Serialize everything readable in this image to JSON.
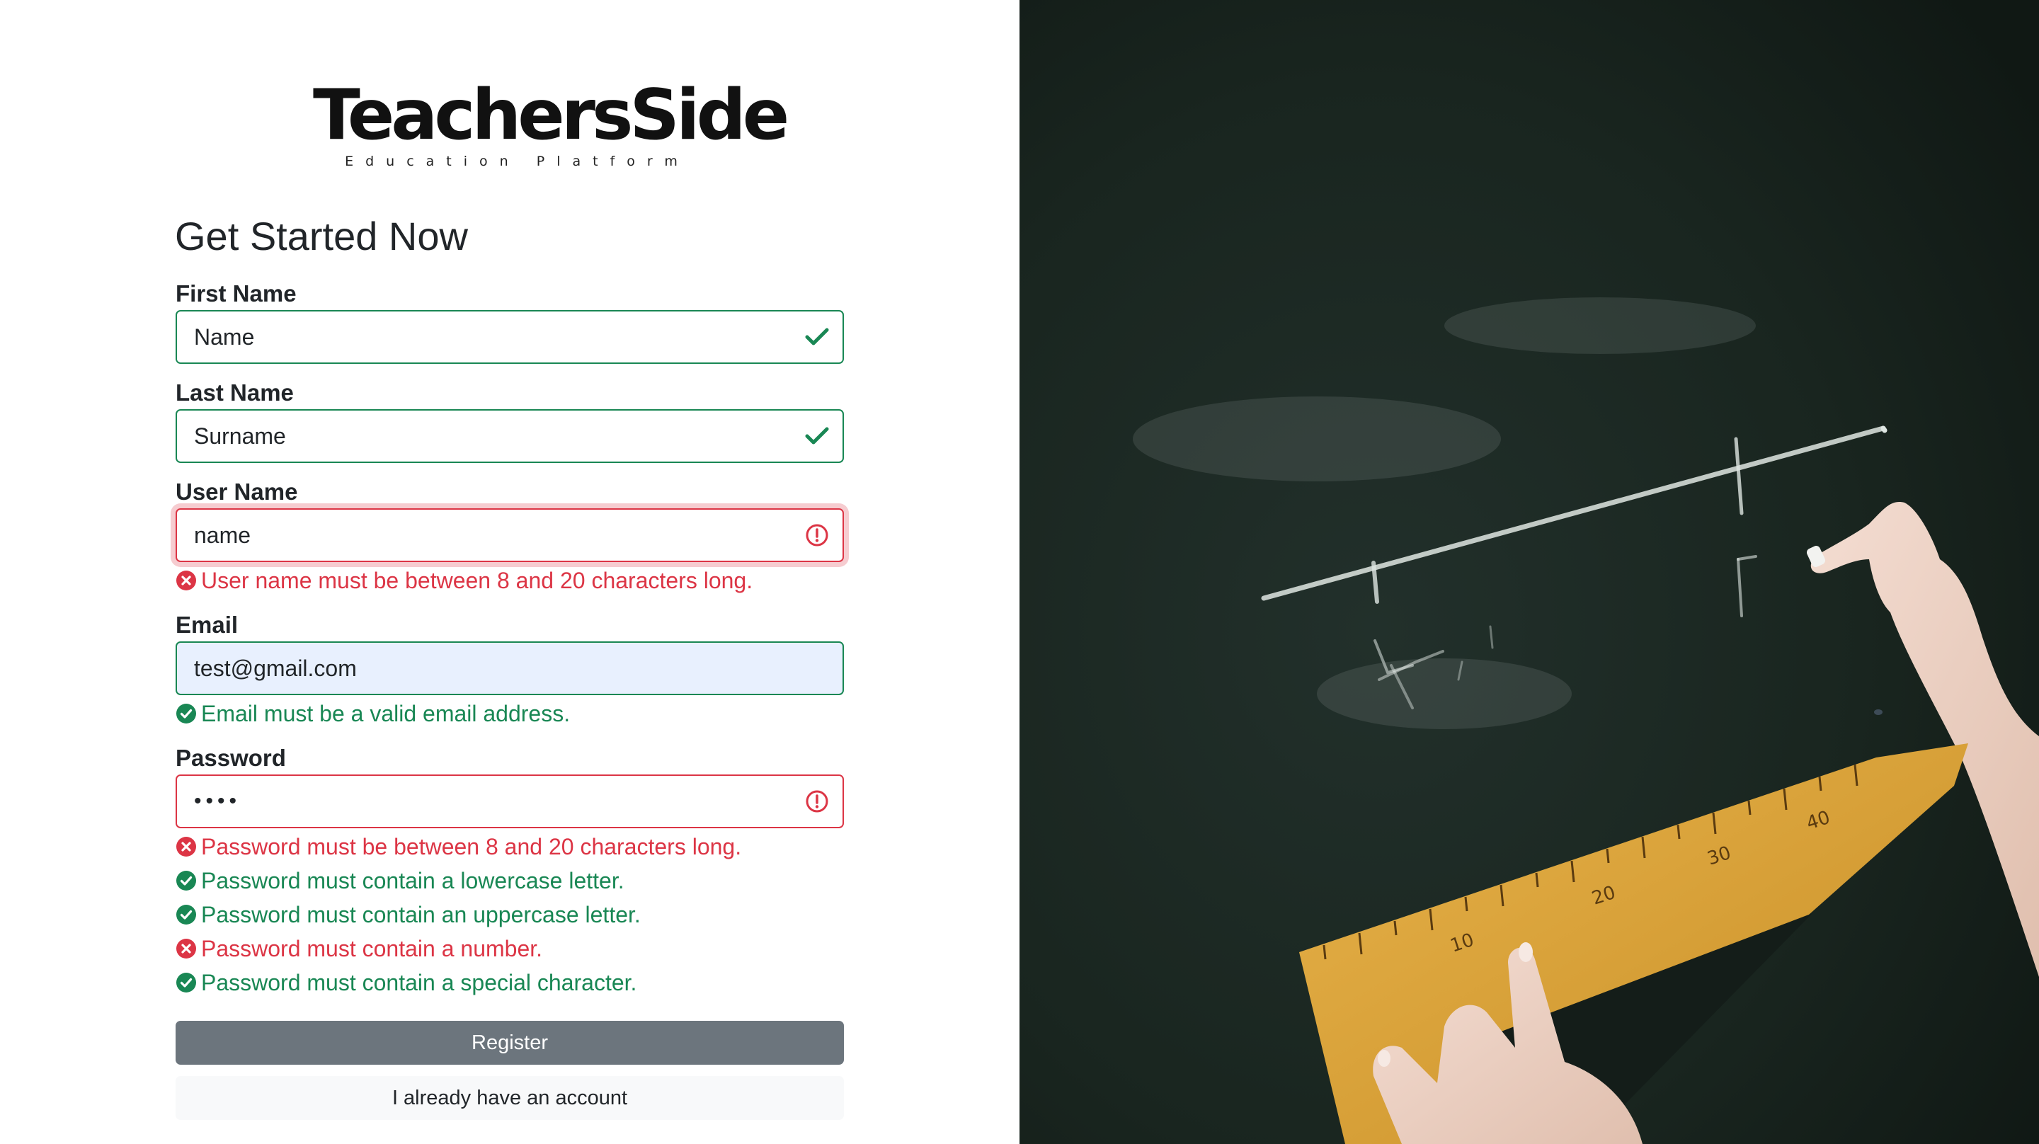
{
  "brand": {
    "name": "TeachersSide",
    "tagline": "Education Platform"
  },
  "form": {
    "title": "Get Started Now",
    "fields": {
      "first_name": {
        "label": "First Name",
        "value": "Name",
        "state": "valid"
      },
      "last_name": {
        "label": "Last Name",
        "value": "Surname",
        "state": "valid"
      },
      "user_name": {
        "label": "User Name",
        "value": "name",
        "state": "invalid",
        "feedback": [
          {
            "status": "error",
            "text": "User name must be between 8 and 20 characters long."
          }
        ]
      },
      "email": {
        "label": "Email",
        "value": "test@gmail.com",
        "state": "valid",
        "feedback": [
          {
            "status": "ok",
            "text": "Email must be a valid email address."
          }
        ]
      },
      "password": {
        "label": "Password",
        "value": "••••",
        "state": "invalid",
        "feedback": [
          {
            "status": "error",
            "text": "Password must be between 8 and 20 characters long."
          },
          {
            "status": "ok",
            "text": "Password must contain a lowercase letter."
          },
          {
            "status": "ok",
            "text": "Password must contain an uppercase letter."
          },
          {
            "status": "error",
            "text": "Password must contain a number."
          },
          {
            "status": "ok",
            "text": "Password must contain a special character."
          }
        ]
      }
    },
    "register_label": "Register",
    "login_label": "I already have an account"
  },
  "hero": {
    "icon": "chalkboard-photo",
    "ruler_marks": [
      "10",
      "20",
      "30",
      "40"
    ]
  },
  "colors": {
    "valid": "#198754",
    "invalid": "#dc3545",
    "register_button": "#6c757d",
    "secondary_button": "#f8f9fa",
    "autofill": "#e8f0fe",
    "chalkboard": "#17221e",
    "ruler": "#d9a335"
  }
}
